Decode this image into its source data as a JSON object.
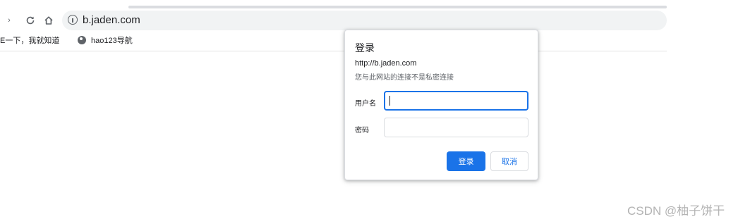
{
  "browser": {
    "nav": {
      "forward_icon": "chevron-right-icon",
      "reload_icon": "reload-icon",
      "home_icon": "home-icon"
    },
    "omnibox": {
      "icon": "info-icon",
      "url": "b.jaden.com"
    },
    "bookmarks": [
      {
        "label": "E一下，我就知道"
      },
      {
        "label": "hao123导航",
        "icon": "globe-icon"
      }
    ]
  },
  "dialog": {
    "title": "登录",
    "url": "http://b.jaden.com",
    "warning": "您与此网站的连接不是私密连接",
    "username": {
      "label": "用户名",
      "value": ""
    },
    "password": {
      "label": "密码",
      "value": ""
    },
    "submit_label": "登录",
    "cancel_label": "取消",
    "accent_color": "#1a73e8"
  },
  "watermark": "CSDN @柚子饼干"
}
